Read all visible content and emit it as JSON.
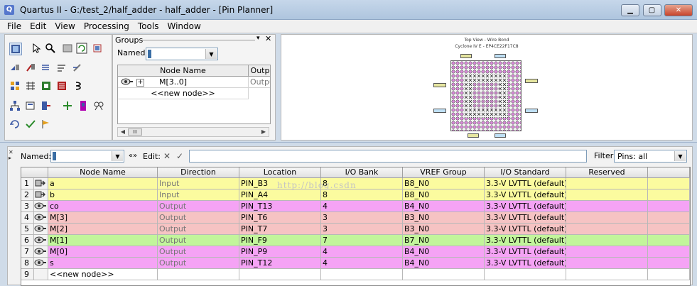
{
  "window": {
    "title": "Quartus II - G:/test_2/half_adder - half_adder - [Pin Planner]",
    "controls": [
      "minimize",
      "maximize",
      "close"
    ]
  },
  "menu": [
    "File",
    "Edit",
    "View",
    "Processing",
    "Tools",
    "Window"
  ],
  "groups_panel": {
    "title": "Groups",
    "named_label": "Named:",
    "named_value": "",
    "columns": [
      "Node Name",
      "Outpu"
    ],
    "rows": [
      {
        "name": "M[3..0]",
        "direction": "Outpu",
        "expander": "+"
      },
      {
        "name": "<<new node>>",
        "direction": ""
      }
    ],
    "scroll_thumb": "III"
  },
  "chip_view": {
    "title": "Top View - Wire Bond",
    "device": "Cyclone IV E - EP4CE22F17C8"
  },
  "pin_planner": {
    "named_label": "Named:",
    "named_value": "",
    "edit_label": "Edit:",
    "filter_label": "Filter:",
    "filter_value": "Pins: all",
    "columns": [
      "",
      "Node Name",
      "Direction",
      "Location",
      "I/O Bank",
      "VREF Group",
      "I/O Standard",
      "Reserved"
    ],
    "rows": [
      {
        "num": "1",
        "name": "a",
        "direction": "Input",
        "location": "PIN_B3",
        "bank": "8",
        "vref": "B8_N0",
        "standard": "3.3-V LVTTL (default)",
        "reserved": "",
        "color": "#fbfb9f",
        "kind": "input"
      },
      {
        "num": "2",
        "name": "b",
        "direction": "Input",
        "location": "PIN_A4",
        "bank": "8",
        "vref": "B8_N0",
        "standard": "3.3-V LVTTL (default)",
        "reserved": "",
        "color": "#fbfb9f",
        "kind": "input"
      },
      {
        "num": "3",
        "name": "co",
        "direction": "Output",
        "location": "PIN_T13",
        "bank": "4",
        "vref": "B4_N0",
        "standard": "3.3-V LVTTL (default)",
        "reserved": "",
        "color": "#f5a3f5",
        "kind": "output"
      },
      {
        "num": "4",
        "name": "M[3]",
        "direction": "Output",
        "location": "PIN_T6",
        "bank": "3",
        "vref": "B3_N0",
        "standard": "3.3-V LVTTL (default)",
        "reserved": "",
        "color": "#f6c3c3",
        "kind": "output"
      },
      {
        "num": "5",
        "name": "M[2]",
        "direction": "Output",
        "location": "PIN_T7",
        "bank": "3",
        "vref": "B3_N0",
        "standard": "3.3-V LVTTL (default)",
        "reserved": "",
        "color": "#f6c3c3",
        "kind": "output"
      },
      {
        "num": "6",
        "name": "M[1]",
        "direction": "Output",
        "location": "PIN_F9",
        "bank": "7",
        "vref": "B7_N0",
        "standard": "3.3-V LVTTL (default)",
        "reserved": "",
        "color": "#c2f59b",
        "kind": "output"
      },
      {
        "num": "7",
        "name": "M[0]",
        "direction": "Output",
        "location": "PIN_P9",
        "bank": "4",
        "vref": "B4_N0",
        "standard": "3.3-V LVTTL (default)",
        "reserved": "",
        "color": "#f5a3f5",
        "kind": "output"
      },
      {
        "num": "8",
        "name": "s",
        "direction": "Output",
        "location": "PIN_T12",
        "bank": "4",
        "vref": "B4_N0",
        "standard": "3.3-V LVTTL (default)",
        "reserved": "",
        "color": "#f5a3f5",
        "kind": "output"
      },
      {
        "num": "9",
        "name": "<<new node>>",
        "direction": "",
        "location": "",
        "bank": "",
        "vref": "",
        "standard": "",
        "reserved": "",
        "color": "#ffffff",
        "kind": "new"
      }
    ]
  },
  "watermark": "http://blog.csdn"
}
